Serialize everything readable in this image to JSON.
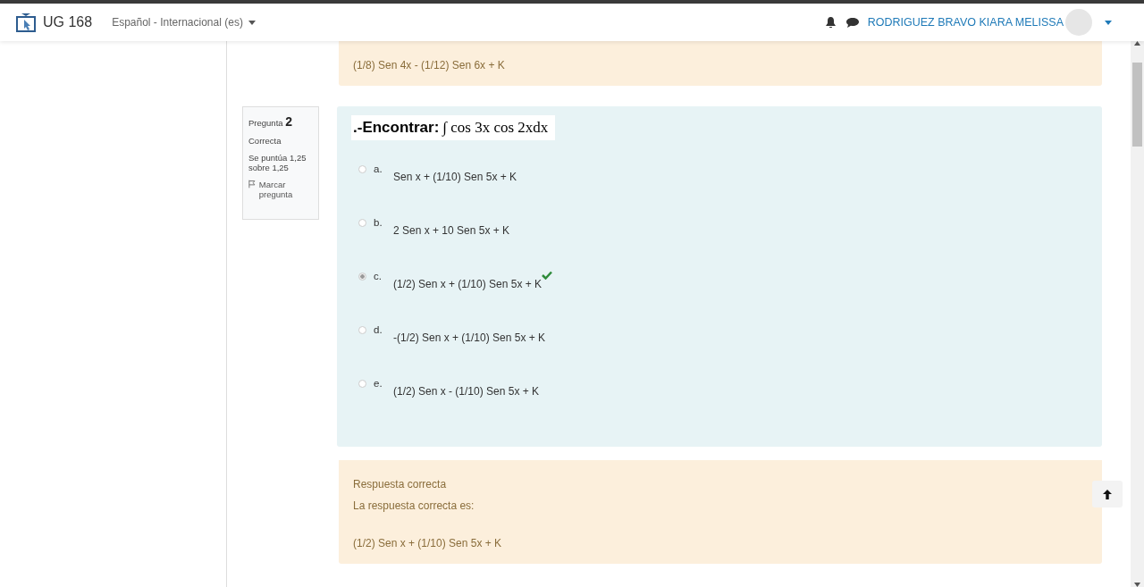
{
  "header": {
    "site": "UG 168",
    "language": "Español - Internacional (es)",
    "user": "RODRIGUEZ BRAVO KIARA MELISSA"
  },
  "previous_feedback": {
    "answer": "(1/8) Sen 4x - (1/12) Sen 6x + K"
  },
  "question_info": {
    "label": "Pregunta",
    "number": "2",
    "state": "Correcta",
    "grade": "Se puntúa 1,25 sobre 1,25",
    "flag": "Marcar pregunta"
  },
  "question": {
    "prompt": ".-Encontrar:",
    "formula": "∫ cos 3x cos 2xdx",
    "options": [
      {
        "letter": "a.",
        "text": "Sen x + (1/10) Sen 5x + K",
        "selected": false,
        "correct": false
      },
      {
        "letter": "b.",
        "text": "2 Sen x + 10 Sen 5x + K",
        "selected": false,
        "correct": false
      },
      {
        "letter": "c.",
        "text": "(1/2) Sen x + (1/10) Sen 5x + K",
        "selected": true,
        "correct": true
      },
      {
        "letter": "d.",
        "text": "-(1/2) Sen x + (1/10) Sen 5x + K",
        "selected": false,
        "correct": false
      },
      {
        "letter": "e.",
        "text": "(1/2) Sen x - (1/10) Sen 5x + K",
        "selected": false,
        "correct": false
      }
    ]
  },
  "feedback": {
    "status": "Respuesta correcta",
    "intro": "La respuesta correcta es:",
    "answer": "(1/2) Sen x + (1/10) Sen 5x + K"
  }
}
